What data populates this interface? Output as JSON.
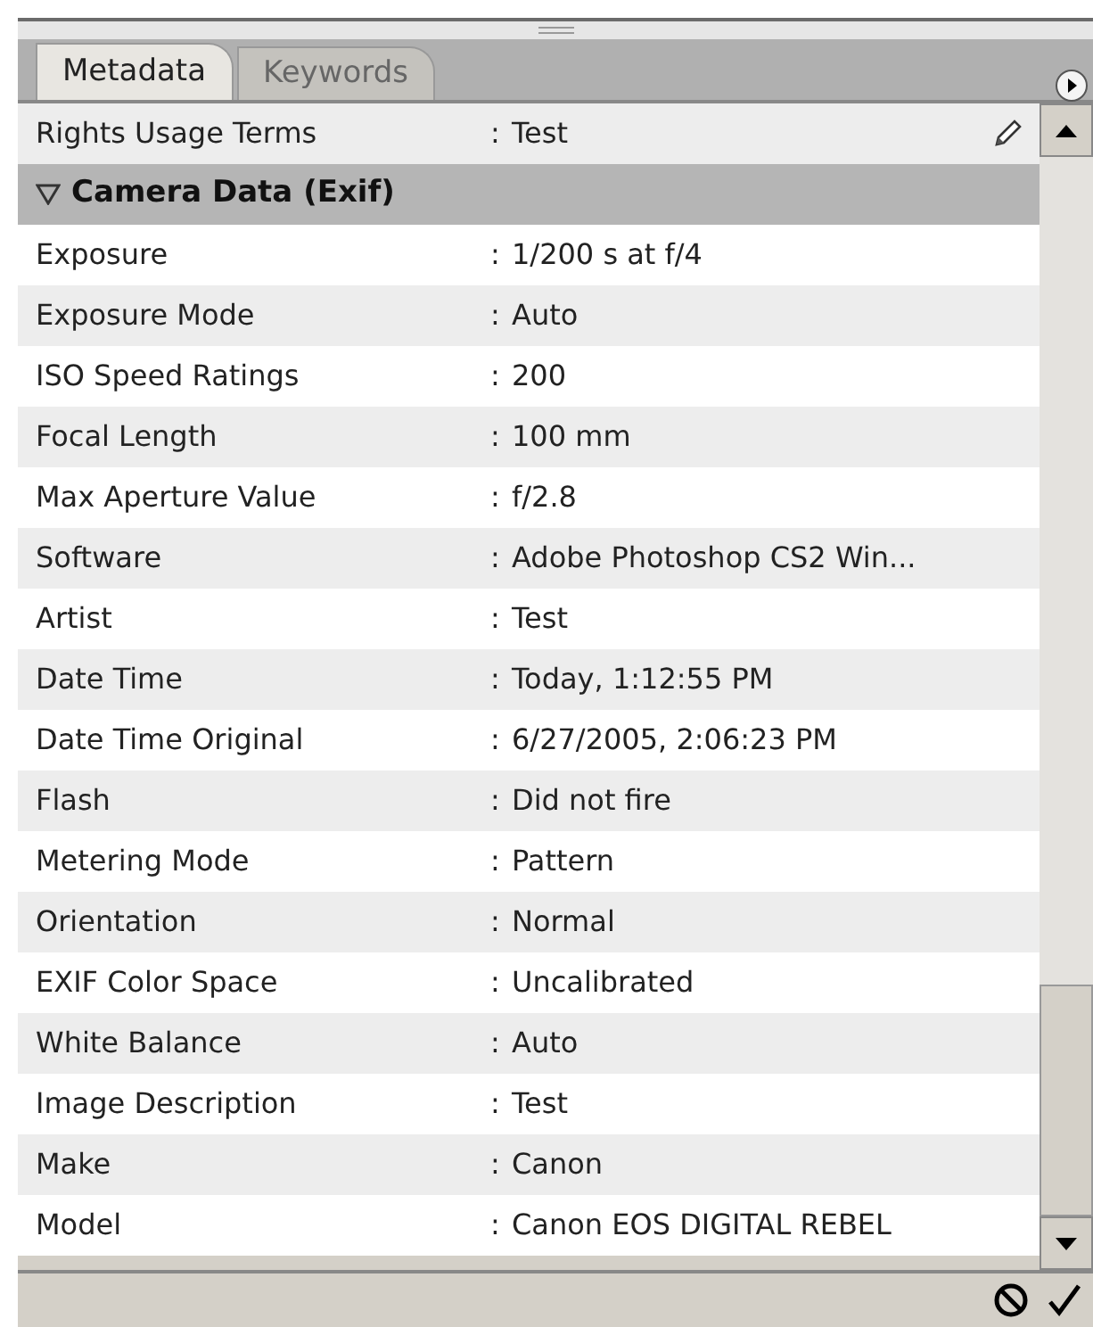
{
  "tabs": [
    {
      "label": "Metadata",
      "selected": true
    },
    {
      "label": "Keywords",
      "selected": false
    }
  ],
  "rows": [
    {
      "kind": "field",
      "label": "Rights Usage Terms",
      "separator": ":",
      "value": "Test",
      "editable": true
    },
    {
      "kind": "section",
      "label": "Camera Data (Exif)",
      "expanded": true
    },
    {
      "kind": "field",
      "label": "Exposure",
      "separator": ":",
      "value": "1/200 s at f/4"
    },
    {
      "kind": "field",
      "label": "Exposure Mode",
      "separator": ":",
      "value": "Auto"
    },
    {
      "kind": "field",
      "label": "ISO Speed Ratings",
      "separator": ":",
      "value": "200"
    },
    {
      "kind": "field",
      "label": "Focal Length",
      "separator": ":",
      "value": "100 mm"
    },
    {
      "kind": "field",
      "label": "Max Aperture Value",
      "separator": ":",
      "value": "f/2.8"
    },
    {
      "kind": "field",
      "label": "Software",
      "separator": ":",
      "value": "Adobe Photoshop CS2 Win..."
    },
    {
      "kind": "field",
      "label": "Artist",
      "separator": ":",
      "value": "Test"
    },
    {
      "kind": "field",
      "label": "Date Time",
      "separator": ":",
      "value": "Today, 1:12:55 PM"
    },
    {
      "kind": "field",
      "label": "Date Time Original",
      "separator": ":",
      "value": "6/27/2005, 2:06:23 PM"
    },
    {
      "kind": "field",
      "label": "Flash",
      "separator": ":",
      "value": "Did not fire"
    },
    {
      "kind": "field",
      "label": "Metering Mode",
      "separator": ":",
      "value": "Pattern"
    },
    {
      "kind": "field",
      "label": "Orientation",
      "separator": ":",
      "value": "Normal"
    },
    {
      "kind": "field",
      "label": "EXIF Color Space",
      "separator": ":",
      "value": "Uncalibrated"
    },
    {
      "kind": "field",
      "label": "White Balance",
      "separator": ":",
      "value": "Auto"
    },
    {
      "kind": "field",
      "label": "Image Description",
      "separator": ":",
      "value": "Test"
    },
    {
      "kind": "field",
      "label": "Make",
      "separator": ":",
      "value": "Canon"
    },
    {
      "kind": "field",
      "label": "Model",
      "separator": ":",
      "value": "Canon EOS DIGITAL REBEL"
    }
  ]
}
